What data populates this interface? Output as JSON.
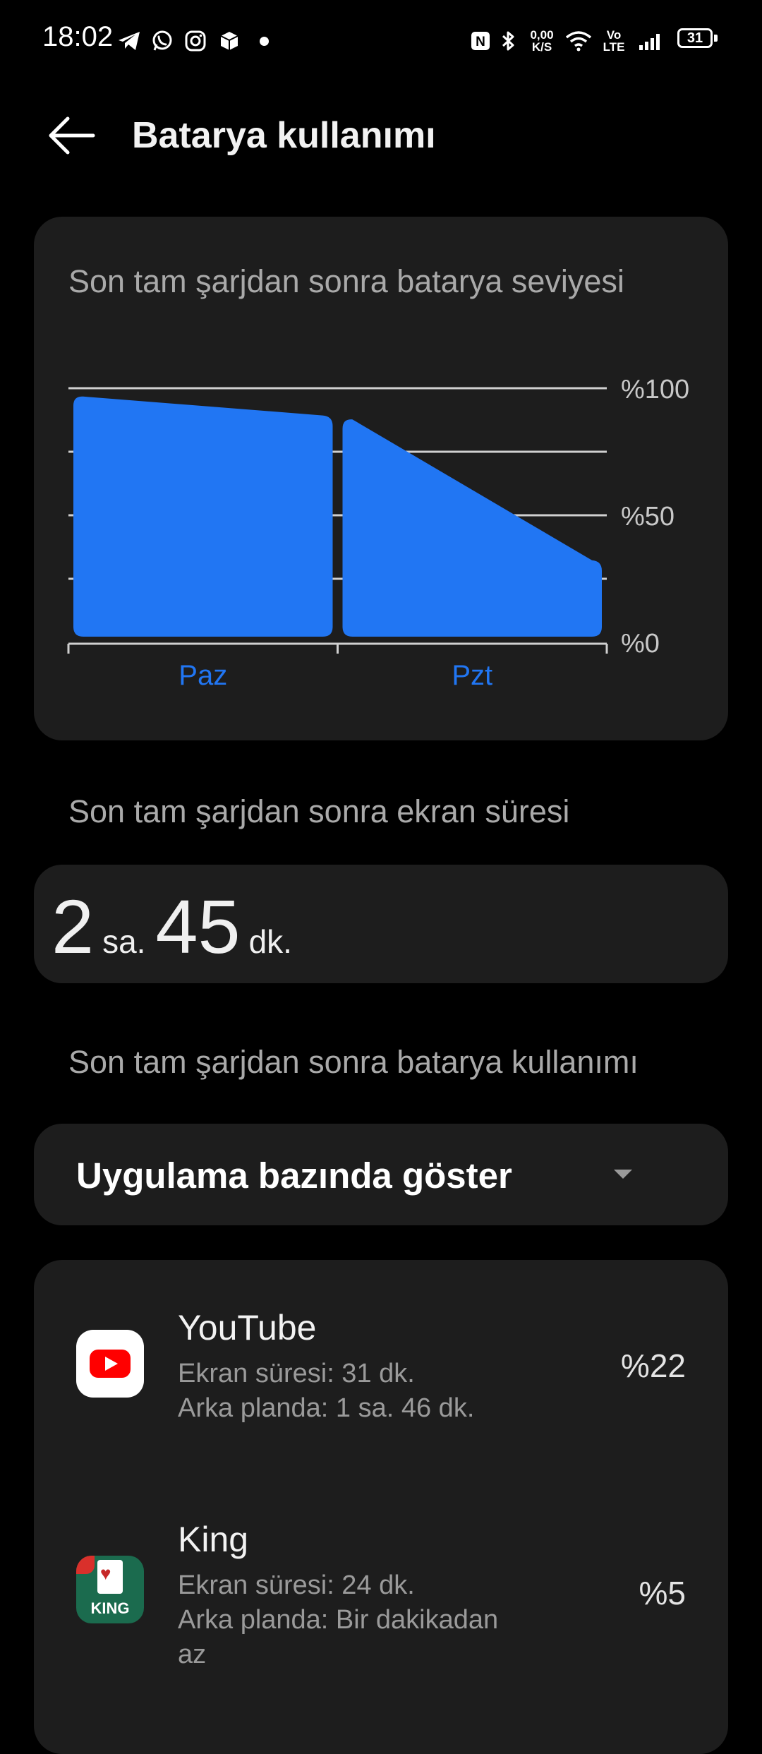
{
  "status_bar": {
    "time": "18:02",
    "left_icons": [
      "telegram-icon",
      "whatsapp-icon",
      "instagram-icon",
      "box-icon",
      "dot-icon"
    ],
    "nfc": "N",
    "bluetooth": "bluetooth-icon",
    "net_speed_value": "0,00",
    "net_speed_unit": "K/S",
    "wifi": "wifi-icon",
    "volte_top": "Vo",
    "volte_bottom": "LTE",
    "signal": "signal-icon",
    "battery": "31"
  },
  "header": {
    "back_icon": "arrow-left-icon",
    "title": "Batarya kullanımı"
  },
  "battery_chart": {
    "title": "Son tam şarjdan sonra batarya seviyesi"
  },
  "chart_data": {
    "type": "area",
    "title": "Son tam şarjdan sonra batarya seviyesi",
    "categories": [
      "Paz",
      "Pzt"
    ],
    "y_tick_labels": [
      "%100",
      "%50",
      "%0"
    ],
    "ylim": [
      0,
      100
    ],
    "grid": true,
    "segments": [
      {
        "category": "Paz",
        "start": 97,
        "end": 89
      },
      {
        "category": "Pzt",
        "start": 88,
        "end": 32
      }
    ],
    "color": "#2176F3"
  },
  "screen_time": {
    "label": "Son tam şarjdan sonra ekran süresi",
    "hours": "2",
    "hours_unit": "sa.",
    "minutes": "45",
    "minutes_unit": "dk."
  },
  "usage": {
    "label": "Son tam şarjdan sonra batarya kullanımı",
    "dropdown": "Uygulama bazında göster",
    "dropdown_icon": "caret-down-icon"
  },
  "apps": [
    {
      "name": "YouTube",
      "icon": "youtube-icon",
      "screen": "Ekran süresi: 31 dk.",
      "background": "Arka planda: 1 sa. 46 dk.",
      "percent": "%22"
    },
    {
      "name": "King",
      "icon": "king-icon",
      "icon_text": "KING",
      "screen": "Ekran süresi: 24 dk.",
      "background_line1": "Arka planda: Bir dakikadan",
      "background_line2": "az",
      "percent": "%5"
    }
  ],
  "colors": {
    "background": "#000000",
    "card": "#1D1D1D",
    "accent": "#2176F3",
    "muted_text": "#A9A9A9"
  }
}
